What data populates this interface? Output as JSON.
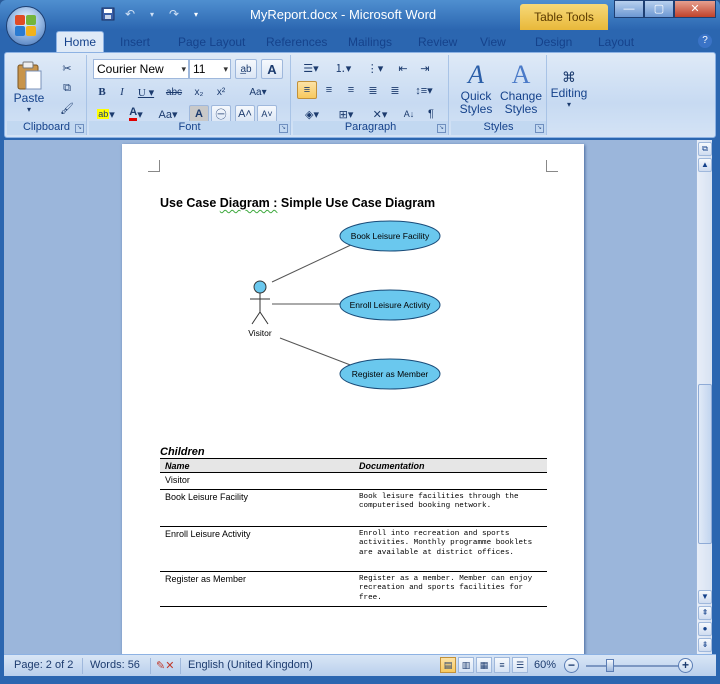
{
  "window": {
    "title": "MyReport.docx - Microsoft Word",
    "contextual_tab": "Table Tools"
  },
  "tabs": [
    "Home",
    "Insert",
    "Page Layout",
    "References",
    "Mailings",
    "Review",
    "View",
    "Design",
    "Layout"
  ],
  "active_tab": "Home",
  "ribbon": {
    "clipboard": {
      "label": "Clipboard",
      "paste": "Paste"
    },
    "font": {
      "label": "Font",
      "font_name": "Courier New",
      "font_size": "11"
    },
    "paragraph": {
      "label": "Paragraph"
    },
    "styles": {
      "label": "Styles",
      "quick_styles": "Quick\nStyles",
      "change_styles": "Change\nStyles"
    },
    "editing": {
      "label": "Editing"
    }
  },
  "document": {
    "heading_prefix": "Use Case",
    "heading_squiggle": "Diagram :",
    "heading_suffix": "Simple Use Case Diagram",
    "diagram": {
      "actor": "Visitor",
      "use_cases": [
        "Book Leisure Facility",
        "Enroll Leisure Activity",
        "Register as Member"
      ]
    },
    "children_title": "Children",
    "table": {
      "headers": [
        "Name",
        "Documentation"
      ],
      "rows": [
        {
          "name": "Visitor",
          "doc": ""
        },
        {
          "name": "Book Leisure Facility",
          "doc": "Book leisure facilities through the computerised booking network."
        },
        {
          "name": "Enroll Leisure Activity",
          "doc": "Enroll into recreation and sports activities. Monthly programme booklets are available at district offices."
        },
        {
          "name": "Register as Member",
          "doc": "Register as a member. Member can enjoy recreation and sports facilities for free."
        }
      ]
    }
  },
  "status": {
    "page": "Page: 2 of 2",
    "words": "Words: 56",
    "language": "English (United Kingdom)",
    "zoom": "60%"
  },
  "colors": {
    "use_case_fill": "#6ac8ee",
    "actor_fill": "#6ac8ee",
    "ribbon_text": "#15428b"
  }
}
